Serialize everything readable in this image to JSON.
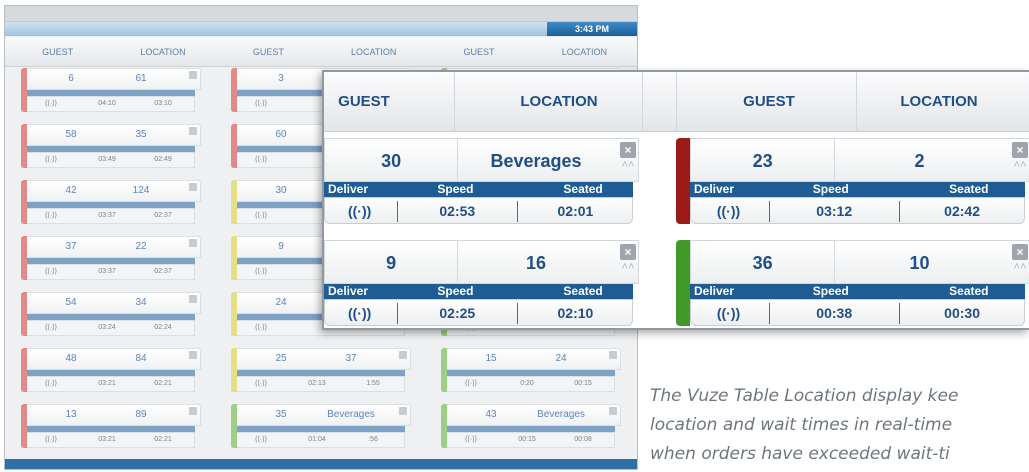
{
  "app": {
    "clock": "3:43 PM",
    "header_labels": [
      "GUEST",
      "LOCATION",
      "GUEST",
      "LOCATION",
      "GUEST",
      "LOCATION"
    ],
    "columns": [
      {
        "strip_colors": [
          "#e28a8a",
          "#e28a8a",
          "#e28a8a",
          "#e28a8a",
          "#e28a8a",
          "#e28a8a",
          "#e28a8a"
        ],
        "cards": [
          {
            "guest": "6",
            "location": "61",
            "speed": "04:10",
            "seated": "03:10"
          },
          {
            "guest": "58",
            "location": "35",
            "speed": "03:49",
            "seated": "02:49"
          },
          {
            "guest": "42",
            "location": "124",
            "speed": "03:37",
            "seated": "02:37"
          },
          {
            "guest": "37",
            "location": "22",
            "speed": "03:37",
            "seated": "02:37"
          },
          {
            "guest": "54",
            "location": "34",
            "speed": "03:24",
            "seated": "02:24"
          },
          {
            "guest": "48",
            "location": "84",
            "speed": "03:21",
            "seated": "02:21"
          },
          {
            "guest": "13",
            "location": "89",
            "speed": "03:21",
            "seated": "02:21"
          }
        ]
      },
      {
        "strip_colors": [
          "#e28a8a",
          "#e28a8a",
          "#e6df8a",
          "#e6df8a",
          "#e6df8a",
          "#e6df8a",
          "#9fcf85"
        ],
        "cards": [
          {
            "guest": "3",
            "location": "",
            "speed": "",
            "seated": ""
          },
          {
            "guest": "60",
            "location": "",
            "speed": "",
            "seated": ""
          },
          {
            "guest": "30",
            "location": "",
            "speed": "",
            "seated": ""
          },
          {
            "guest": "9",
            "location": "",
            "speed": "",
            "seated": ""
          },
          {
            "guest": "24",
            "location": "",
            "speed": "",
            "seated": ""
          },
          {
            "guest": "25",
            "location": "37",
            "speed": "02:13",
            "seated": "1:55"
          },
          {
            "guest": "35",
            "location": "Beverages",
            "speed": "01:04",
            "seated": ":56"
          }
        ]
      },
      {
        "strip_colors": [
          "#9fcf85",
          "#9fcf85",
          "#9fcf85",
          "#9fcf85",
          "#9fcf85",
          "#9fcf85",
          "#9fcf85"
        ],
        "cards": [
          {
            "guest": "",
            "location": "",
            "speed": "",
            "seated": ""
          },
          {
            "guest": "",
            "location": "",
            "speed": "",
            "seated": ""
          },
          {
            "guest": "",
            "location": "",
            "speed": "",
            "seated": ""
          },
          {
            "guest": "",
            "location": "",
            "speed": "",
            "seated": ""
          },
          {
            "guest": "",
            "location": "",
            "speed": "",
            "seated": ""
          },
          {
            "guest": "15",
            "location": "24",
            "speed": "0:20",
            "seated": "00:15"
          },
          {
            "guest": "43",
            "location": "Beverages",
            "speed": "00:15",
            "seated": "00:08"
          }
        ]
      }
    ],
    "mini_band_labels": [
      "Deliver",
      "Speed",
      "Seated"
    ]
  },
  "zoom": {
    "headers": [
      "GUEST",
      "LOCATION",
      "GUEST",
      "LOCATION"
    ],
    "band_labels": {
      "deliver": "Deliver",
      "speed": "Speed",
      "seated": "Seated"
    },
    "wifi_icon": "((·))",
    "close_icon": "×",
    "up_icon": "˄˄",
    "cards": [
      {
        "guest": "30",
        "location": "Beverages",
        "speed": "02:53",
        "seated": "02:01",
        "strip_color": ""
      },
      {
        "guest": "23",
        "location": "2",
        "speed": "03:12",
        "seated": "02:42",
        "strip_color": "#9b1a1a"
      },
      {
        "guest": "9",
        "location": "16",
        "speed": "02:25",
        "seated": "02:10",
        "strip_color": ""
      },
      {
        "guest": "36",
        "location": "10",
        "speed": "00:38",
        "seated": "00:30",
        "strip_color": "#3f9a2a"
      }
    ]
  },
  "caption": {
    "line1": "The Vuze Table Location display kee",
    "line2": "location and wait times in real-time",
    "line3": "when orders have exceeded wait-ti"
  }
}
